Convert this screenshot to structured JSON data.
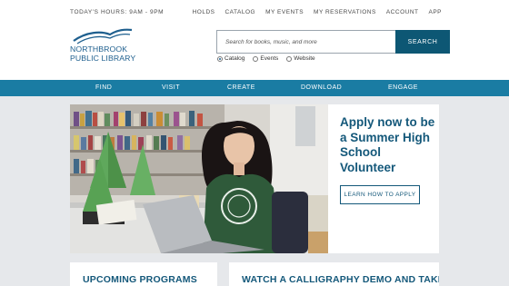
{
  "header": {
    "hours": "TODAY'S HOURS: 9AM - 9PM",
    "utility_links": [
      "HOLDS",
      "CATALOG",
      "MY EVENTS",
      "MY RESERVATIONS",
      "ACCOUNT",
      "APP"
    ]
  },
  "logo": {
    "line1": "NORTHBROOK",
    "line2": "PUBLIC LIBRARY"
  },
  "search": {
    "placeholder": "Search for books, music, and more",
    "button": "SEARCH",
    "scopes": [
      {
        "label": "Catalog",
        "selected": true
      },
      {
        "label": "Events",
        "selected": false
      },
      {
        "label": "Website",
        "selected": false
      }
    ]
  },
  "nav": [
    "FIND",
    "VISIT",
    "CREATE",
    "DOWNLOAD",
    "ENGAGE"
  ],
  "hero": {
    "title": "Apply now to be a Summer High School Volunteer",
    "cta": "LEARN HOW TO APPLY"
  },
  "cards": [
    {
      "title": "UPCOMING PROGRAMS"
    },
    {
      "title": "WATCH A CALLIGRAPHY DEMO AND TAKE"
    }
  ],
  "colors": {
    "brand": "#1e5f8e",
    "nav": "#1a7ca3",
    "button": "#0d5774"
  }
}
